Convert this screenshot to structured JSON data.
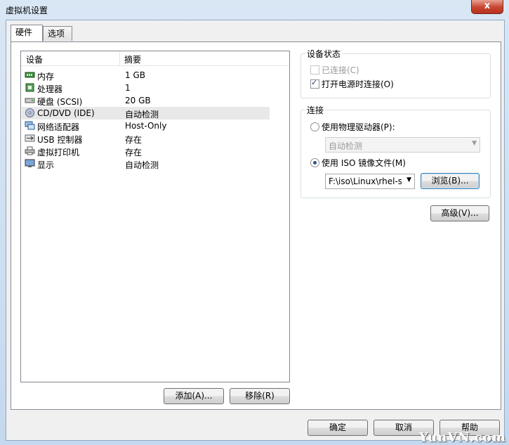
{
  "window": {
    "title": "虚拟机设置",
    "close_glyph": "x"
  },
  "tabs": [
    {
      "label": "硬件"
    },
    {
      "label": "选项"
    }
  ],
  "device_list": {
    "headers": {
      "device": "设备",
      "summary": "摘要"
    },
    "rows": [
      {
        "icon": "memory-icon",
        "name": "内存",
        "summary": "1 GB"
      },
      {
        "icon": "processor-icon",
        "name": "处理器",
        "summary": "1"
      },
      {
        "icon": "hard-disk-icon",
        "name": "硬盘 (SCSI)",
        "summary": "20 GB"
      },
      {
        "icon": "cd-dvd-icon",
        "name": "CD/DVD (IDE)",
        "summary": "自动检测",
        "selected": true
      },
      {
        "icon": "network-adapter-icon",
        "name": "网络适配器",
        "summary": "Host-Only"
      },
      {
        "icon": "usb-icon",
        "name": "USB 控制器",
        "summary": "存在"
      },
      {
        "icon": "printer-icon",
        "name": "虚拟打印机",
        "summary": "存在"
      },
      {
        "icon": "display-icon",
        "name": "显示",
        "summary": "自动检测"
      }
    ]
  },
  "list_buttons": {
    "add": "添加(A)...",
    "remove": "移除(R)"
  },
  "device_status": {
    "legend": "设备状态",
    "connected": {
      "label": "已连接(C)",
      "checked": false,
      "enabled": false
    },
    "connect_on_power_on": {
      "label": "打开电源时连接(O)",
      "checked": true
    }
  },
  "connection": {
    "legend": "连接",
    "physical_drive": {
      "label": "使用物理驱动器(P):",
      "selected": false
    },
    "physical_drive_select": "自动检测",
    "iso_image": {
      "label": "使用 ISO 镜像文件(M)",
      "selected": true
    },
    "iso_path": "F:\\iso\\Linux\\rhel-se",
    "browse": "浏览(B)..."
  },
  "advanced": "高级(V)...",
  "footer": {
    "ok": "确定",
    "cancel": "取消",
    "help": "帮助"
  },
  "watermark": "YunVN.com",
  "colors": {
    "title_bar": "#c4d8ee",
    "close_button": "#c7452f",
    "selected_row": "#e8e8e8"
  }
}
